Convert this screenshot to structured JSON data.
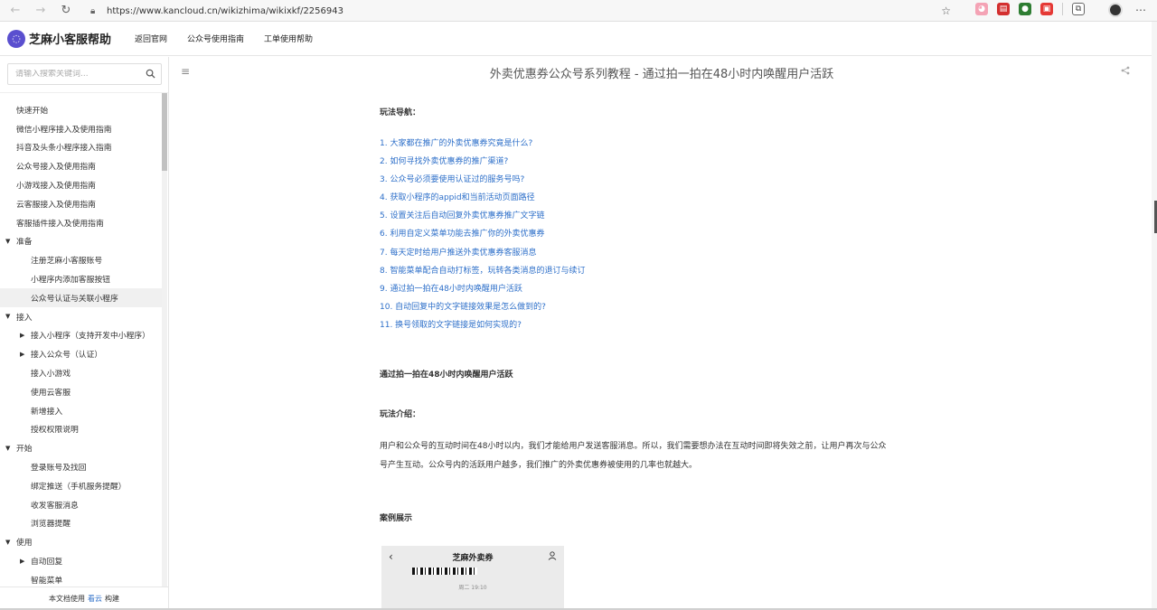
{
  "browser": {
    "url": "https://www.kancloud.cn/wikizhima/wikixkf/2256943",
    "url_host": "https://www.kancloud.cn",
    "url_path": "/wikizhima/wikixkf/2256943"
  },
  "header": {
    "logo_text": "芝麻小客服帮助",
    "links": [
      "返回官网",
      "公众号使用指南",
      "工单使用帮助"
    ]
  },
  "sidebar": {
    "search_placeholder": "请输入搜索关键词...",
    "items": [
      {
        "label": "快速开始",
        "level": "top"
      },
      {
        "label": "微信小程序接入及使用指南",
        "level": "top"
      },
      {
        "label": "抖音及头条小程序接入指南",
        "level": "top"
      },
      {
        "label": "公众号接入及使用指南",
        "level": "top"
      },
      {
        "label": "小游戏接入及使用指南",
        "level": "top"
      },
      {
        "label": "云客服接入及使用指南",
        "level": "top"
      },
      {
        "label": "客服插件接入及使用指南",
        "level": "top"
      },
      {
        "label": "准备",
        "level": "section"
      },
      {
        "label": "注册芝麻小客服账号",
        "level": "child"
      },
      {
        "label": "小程序内添加客服按钮",
        "level": "child"
      },
      {
        "label": "公众号认证与关联小程序",
        "level": "child",
        "active": true
      },
      {
        "label": "接入",
        "level": "section"
      },
      {
        "label": "接入小程序（支持开发中小程序）",
        "level": "group"
      },
      {
        "label": "接入公众号（认证）",
        "level": "group"
      },
      {
        "label": "接入小游戏",
        "level": "child"
      },
      {
        "label": "使用云客服",
        "level": "child"
      },
      {
        "label": "新增接入",
        "level": "child"
      },
      {
        "label": "授权权限说明",
        "level": "child"
      },
      {
        "label": "开始",
        "level": "section"
      },
      {
        "label": "登录账号及找回",
        "level": "child"
      },
      {
        "label": "绑定推送（手机服务提醒）",
        "level": "child"
      },
      {
        "label": "收发客服消息",
        "level": "child"
      },
      {
        "label": "浏览器提醒",
        "level": "child"
      },
      {
        "label": "使用",
        "level": "section"
      },
      {
        "label": "自动回复",
        "level": "group"
      },
      {
        "label": "智能菜单",
        "level": "child"
      }
    ],
    "footer_prefix": "本文档使用",
    "footer_brand": "看云",
    "footer_suffix": "构建"
  },
  "page": {
    "title": "外卖优惠券公众号系列教程 - 通过拍一拍在48小时内唤醒用户活跃"
  },
  "article": {
    "nav_label": "玩法导航：",
    "nav_links": [
      "1. 大家都在推广的外卖优惠券究竟是什么?",
      "2. 如何寻找外卖优惠券的推广渠道?",
      "3. 公众号必须要使用认证过的服务号吗?",
      "4. 获取小程序的appid和当前活动页面路径",
      "5. 设置关注后自动回复外卖优惠券推广文字链",
      "6. 利用自定义菜单功能去推广你的外卖优惠券",
      "7. 每天定时给用户推送外卖优惠券客服消息",
      "8. 智能菜单配合自动打标签，玩转各类消息的退订与续订",
      "9. 通过拍一拍在48小时内唤醒用户活跃",
      "10. 自动回复中的文字链接效果是怎么做到的?",
      "11. 换号领取的文字链接是如何实现的?"
    ],
    "section_title": "通过拍一拍在48小时内唤醒用户活跃",
    "intro_label": "玩法介绍：",
    "intro_line1": "用户和公众号的互动时间在48小时以内，我们才能给用户发送客服消息。所以，我们需要想办法在互动时间即将失效之前，让用户再次与公众",
    "intro_line2": "号产生互动。公众号内的活跃用户越多，我们推广的外卖优惠券被使用的几率也就越大。",
    "case_label": "案例展示",
    "phone_title": "芝麻外卖券",
    "phone_time": "周二 19:10"
  },
  "colors": {
    "link": "#2d6fc9",
    "logo": "#5a4fcf"
  }
}
